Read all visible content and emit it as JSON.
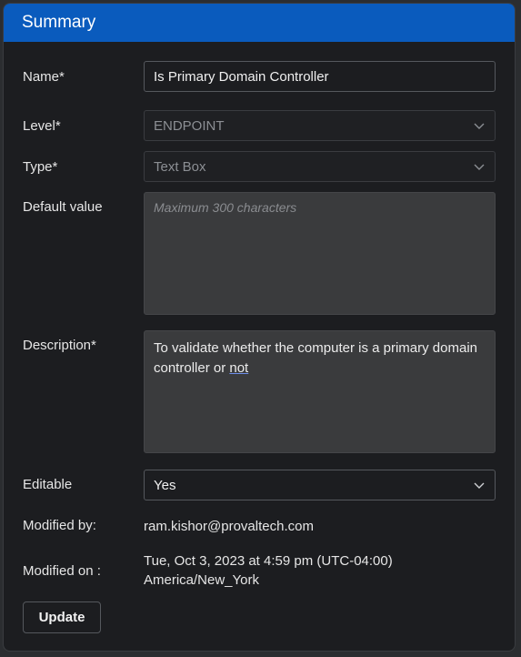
{
  "header": {
    "title": "Summary"
  },
  "form": {
    "name": {
      "label": "Name*",
      "value": "Is Primary Domain Controller"
    },
    "level": {
      "label": "Level*",
      "value": "ENDPOINT"
    },
    "type": {
      "label": "Type*",
      "value": "Text Box"
    },
    "default_value": {
      "label": "Default value",
      "placeholder": "Maximum 300 characters"
    },
    "description": {
      "label": "Description*",
      "value_main": "To validate whether the computer is a primary domain controller or ",
      "value_underlined": "not"
    },
    "editable": {
      "label": "Editable",
      "value": "Yes"
    },
    "modified_by": {
      "label": "Modified by:",
      "value": "ram.kishor@provaltech.com"
    },
    "modified_on": {
      "label": "Modified on :",
      "line1": "Tue, Oct 3, 2023 at 4:59 pm (UTC-04:00)",
      "line2": "America/New_York"
    }
  },
  "actions": {
    "update_label": "Update"
  },
  "icons": {
    "dropdown": "chevron-down-icon"
  },
  "colors": {
    "header": "#0a5bbd",
    "panel": "#1c1d20",
    "textarea": "#3a3b3d"
  }
}
